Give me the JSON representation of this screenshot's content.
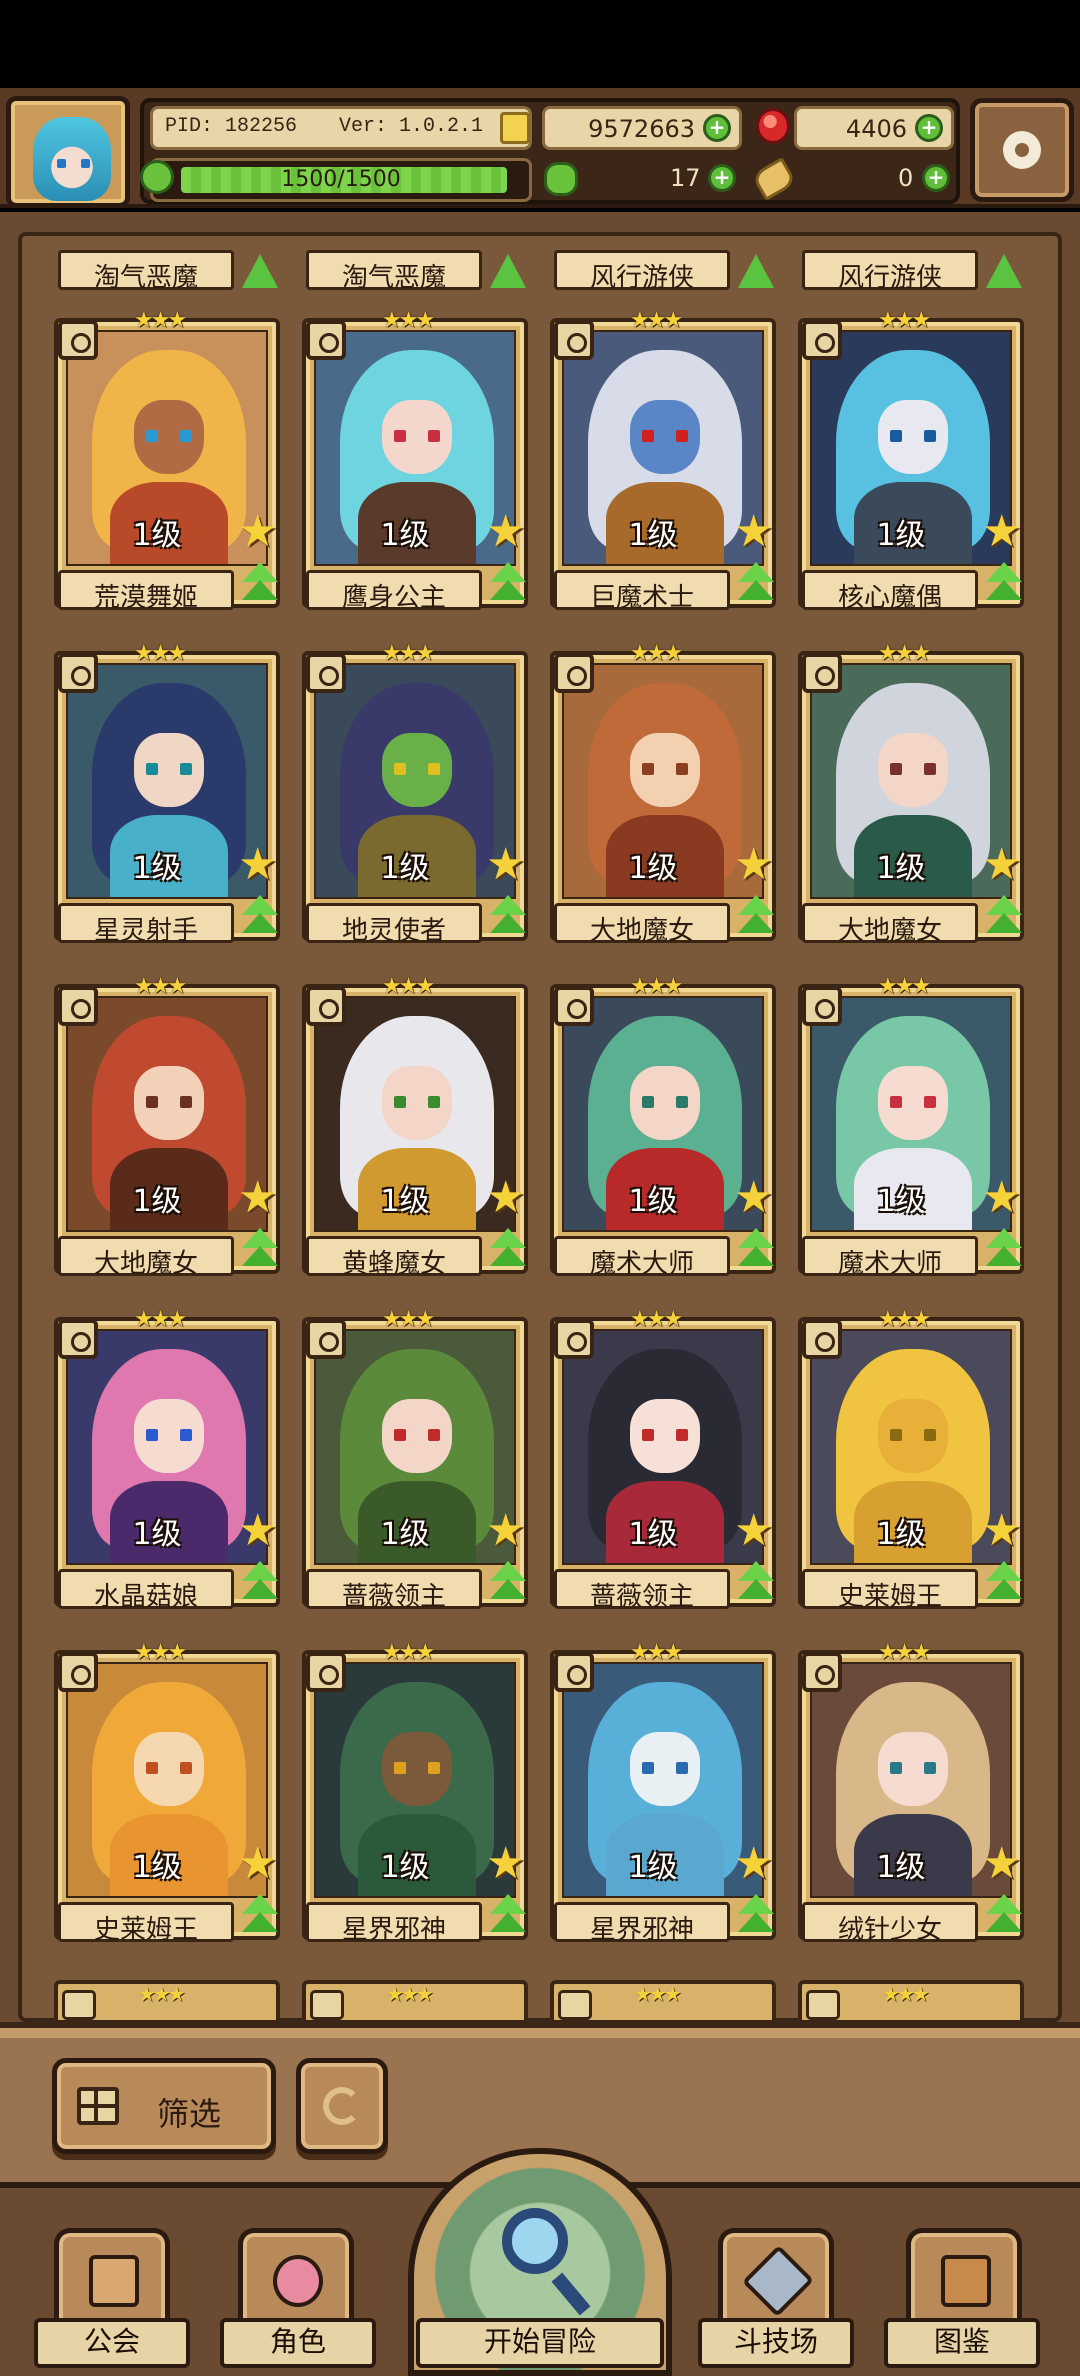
{
  "header": {
    "pid": "PID: 182256",
    "version": "Ver: 1.0.2.1",
    "gold": "9572663",
    "gems": "4406",
    "exp_text": "1500/1500",
    "exp_fraction": 1.0,
    "clover": "17",
    "bone": "0"
  },
  "roster": {
    "top_row": [
      "淘气恶魔",
      "淘气恶魔",
      "风行游侠",
      "风行游侠"
    ],
    "cards": [
      {
        "name": "荒漠舞姬",
        "level": "1级",
        "stars": "★★★",
        "hair": "#f0b448",
        "skin": "#b06a44",
        "body": "#b84a2a",
        "eye": "#2a9ad0",
        "bg": "#c8905a",
        "role": "leaf-icon"
      },
      {
        "name": "鹰身公主",
        "level": "1级",
        "stars": "★★★",
        "hair": "#6ed4e0",
        "skin": "#f3d6cc",
        "body": "#5a3a2a",
        "eye": "#c83040",
        "bg": "#4a6a8a",
        "role": "leaf-icon"
      },
      {
        "name": "巨魔术士",
        "level": "1级",
        "stars": "★★★",
        "hair": "#d8dce8",
        "skin": "#5a86c8",
        "body": "#a86a2a",
        "eye": "#d02020",
        "bg": "#4a5a7a",
        "role": "leaf-icon"
      },
      {
        "name": "核心魔偶",
        "level": "1级",
        "stars": "★★★",
        "hair": "#58c0e0",
        "skin": "#e8e8f0",
        "body": "#3a4a5a",
        "eye": "#1a5aa0",
        "bg": "#2a3a5a",
        "role": "leaf-icon"
      },
      {
        "name": "星灵射手",
        "level": "1级",
        "stars": "★★★",
        "hair": "#2a3a6a",
        "skin": "#f0d6c4",
        "body": "#48b0c8",
        "eye": "#1a8a9a",
        "bg": "#3a5a6a",
        "role": "leaf-icon"
      },
      {
        "name": "地灵使者",
        "level": "1级",
        "stars": "★★★",
        "hair": "#3a3a6a",
        "skin": "#6ab048",
        "body": "#7a6a30",
        "eye": "#e0c020",
        "bg": "#3a4a5a",
        "role": "key-icon"
      },
      {
        "name": "大地魔女",
        "level": "1级",
        "stars": "★★★",
        "hair": "#c06a3a",
        "skin": "#f3d0b0",
        "body": "#8a3a20",
        "eye": "#8a4020",
        "bg": "#a86a3a",
        "role": "key-icon"
      },
      {
        "name": "大地魔女",
        "level": "1级",
        "stars": "★★★",
        "hair": "#d0d4dc",
        "skin": "#f3d6c8",
        "body": "#2a5a4a",
        "eye": "#7a3030",
        "bg": "#4a6a5a",
        "role": "key-icon"
      },
      {
        "name": "大地魔女",
        "level": "1级",
        "stars": "★★★",
        "hair": "#c04a30",
        "skin": "#f3d0b8",
        "body": "#5a2a1a",
        "eye": "#6a3020",
        "bg": "#7a4a2a",
        "role": "key-icon"
      },
      {
        "name": "黄蜂魔女",
        "level": "1级",
        "stars": "★★★",
        "hair": "#e8e8ec",
        "skin": "#f3d6c8",
        "body": "#d09a30",
        "eye": "#3a8a30",
        "bg": "#3a2a20",
        "role": "key-icon"
      },
      {
        "name": "魔术大师",
        "level": "1级",
        "stars": "★★★",
        "hair": "#5ab090",
        "skin": "#f3d6c8",
        "body": "#b82a2a",
        "eye": "#2a7a6a",
        "bg": "#3a4a5a",
        "role": "key-icon"
      },
      {
        "name": "魔术大师",
        "level": "1级",
        "stars": "★★★",
        "hair": "#78c8a8",
        "skin": "#f6dcd0",
        "body": "#e8e8f0",
        "eye": "#c83040",
        "bg": "#3a5a6a",
        "role": "key-icon"
      },
      {
        "name": "水晶菇娘",
        "level": "1级",
        "stars": "★★★",
        "hair": "#e078b0",
        "skin": "#f6dcd0",
        "body": "#4a2a6a",
        "eye": "#2a5ad0",
        "bg": "#3a3a6a",
        "role": "key-icon"
      },
      {
        "name": "蔷薇领主",
        "level": "1级",
        "stars": "★★★",
        "hair": "#5a8a3a",
        "skin": "#f3d6c8",
        "body": "#3a5a2a",
        "eye": "#c02a2a",
        "bg": "#4a5a3a",
        "role": "key-icon"
      },
      {
        "name": "蔷薇领主",
        "level": "1级",
        "stars": "★★★",
        "hair": "#2a2a34",
        "skin": "#f6e0d8",
        "body": "#a82a3a",
        "eye": "#c02a2a",
        "bg": "#3a3a4a",
        "role": "key-icon"
      },
      {
        "name": "史莱姆王",
        "level": "1级",
        "stars": "★★★",
        "hair": "#f0c440",
        "skin": "#e8b038",
        "body": "#d8a030",
        "eye": "#8a6a10",
        "bg": "#4a4a5a",
        "role": "key-icon"
      },
      {
        "name": "史莱姆王",
        "level": "1级",
        "stars": "★★★",
        "hair": "#f0a838",
        "skin": "#f6d8b0",
        "body": "#e89430",
        "eye": "#c05020",
        "bg": "#c88a3a",
        "role": "key-icon"
      },
      {
        "name": "星界邪神",
        "level": "1级",
        "stars": "★★★",
        "hair": "#3a6a4a",
        "skin": "#7a5a3a",
        "body": "#2a5a3a",
        "eye": "#e0a020",
        "bg": "#2a3a3a",
        "role": "key-icon"
      },
      {
        "name": "星界邪神",
        "level": "1级",
        "stars": "★★★",
        "hair": "#58b0d8",
        "skin": "#e8f0f4",
        "body": "#5aa8d0",
        "eye": "#2a6ab0",
        "bg": "#3a5a7a",
        "role": "key-icon"
      },
      {
        "name": "绒针少女",
        "level": "1级",
        "stars": "★★★",
        "hair": "#d8b888",
        "skin": "#f6dcd0",
        "body": "#3a3a4a",
        "eye": "#2a7a8a",
        "bg": "#6a4a3a",
        "role": "leaf-icon"
      }
    ],
    "peek_stars": "★★★"
  },
  "filter": {
    "label": "筛选"
  },
  "nav": {
    "guild": "公会",
    "character": "角色",
    "adventure": "开始冒险",
    "arena": "斗技场",
    "codex": "图鉴"
  }
}
